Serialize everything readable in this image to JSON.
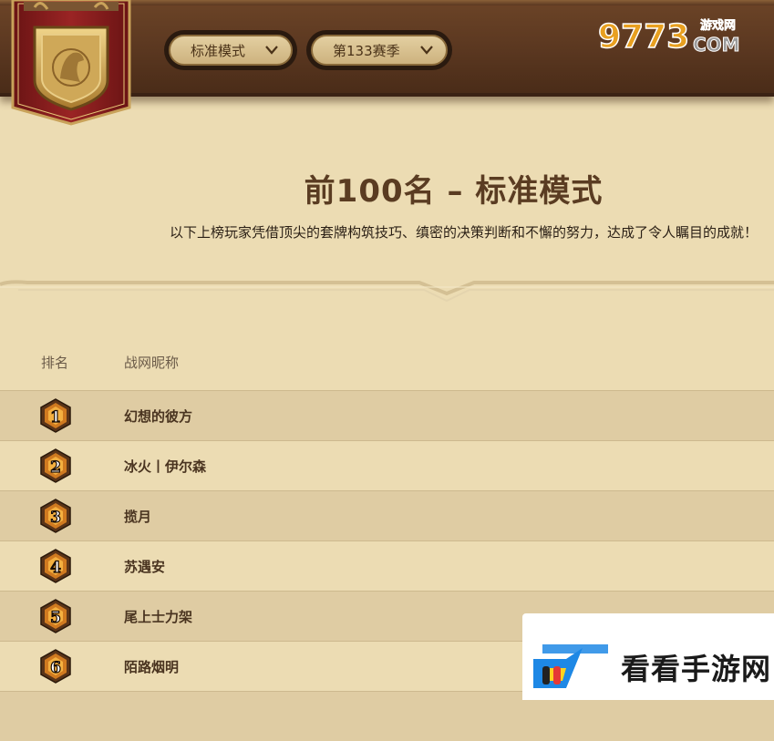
{
  "header": {
    "mode_label": "标准模式",
    "season_label": "第133赛季",
    "logo_text": "9773",
    "logo_sub": "游戏网",
    "logo_com": "COM"
  },
  "page": {
    "title": "前100名 – 标准模式",
    "subtitle": "以下上榜玩家凭借顶尖的套牌构筑技巧、缜密的决策判断和不懈的努力，达成了令人瞩目的成就！"
  },
  "table": {
    "columns": [
      "排名",
      "战网昵称"
    ],
    "rows": [
      {
        "rank": "1",
        "name": "幻想的彼方"
      },
      {
        "rank": "2",
        "name": "冰火丨伊尔森"
      },
      {
        "rank": "3",
        "name": "揽月"
      },
      {
        "rank": "4",
        "name": "苏遇安"
      },
      {
        "rank": "5",
        "name": "尾上士力架"
      },
      {
        "rank": "6",
        "name": "陌路烟明"
      }
    ]
  },
  "watermark": {
    "text": "看看手游网"
  },
  "colors": {
    "header_brown": "#5a3720",
    "page_bg": "#ecdcb3",
    "row_alt": "#dfcca3",
    "banner_red": "#8a1f1f",
    "gold": "#c9a25a"
  }
}
